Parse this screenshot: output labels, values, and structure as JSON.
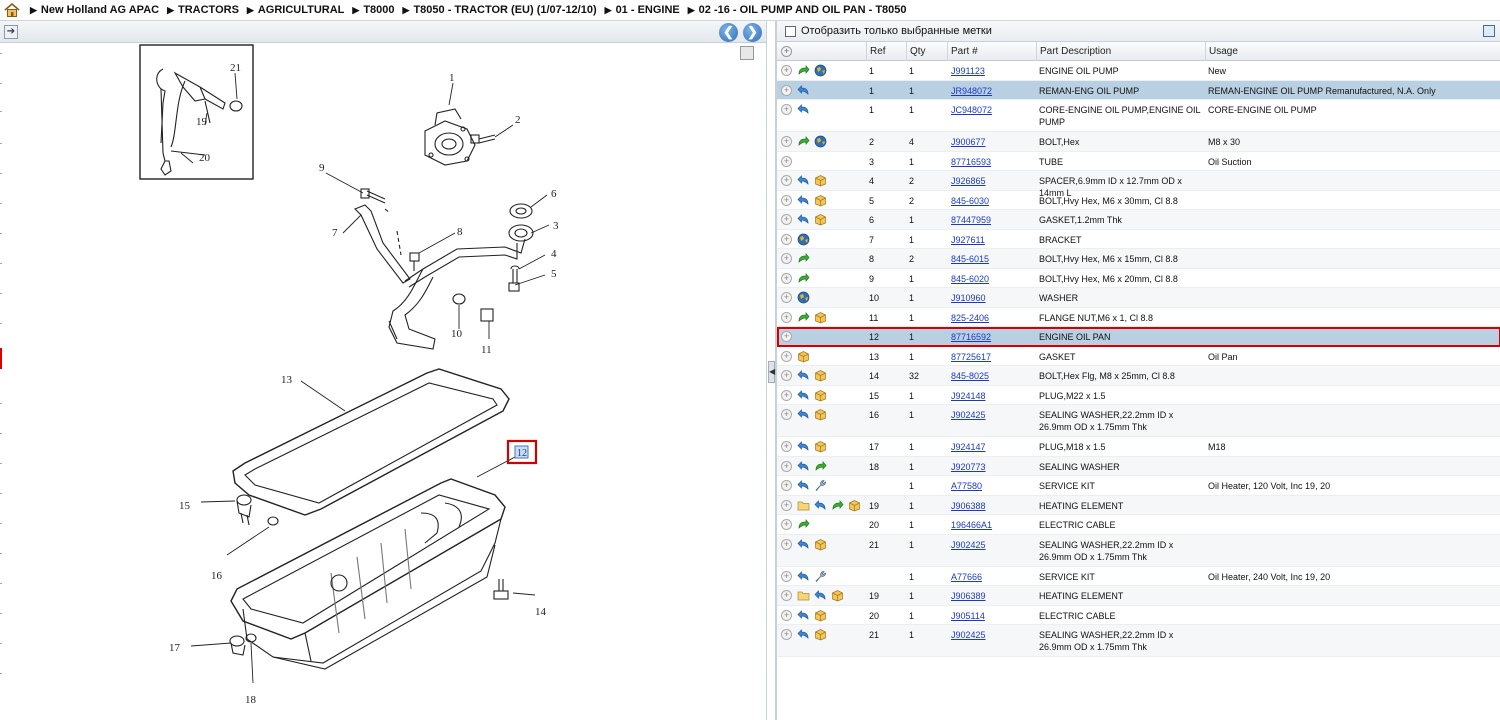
{
  "breadcrumb": [
    "New Holland AG APAC",
    "TRACTORS",
    "AGRICULTURAL",
    "T8000",
    "T8050 - TRACTOR (EU) (1/07-12/10)",
    "01 - ENGINE",
    "02 -16 - OIL PUMP AND OIL PAN - T8050"
  ],
  "filter": {
    "label": "Отобразить только выбранные метки",
    "checked": false
  },
  "columns": {
    "ref": "Ref",
    "qty": "Qty",
    "part": "Part #",
    "desc": "Part Description",
    "usage": "Usage"
  },
  "diagram": {
    "callouts": [
      "1",
      "2",
      "3",
      "4",
      "5",
      "6",
      "7",
      "8",
      "9",
      "10",
      "11",
      "13",
      "14",
      "15",
      "16",
      "17",
      "18",
      "19",
      "20",
      "21"
    ],
    "selected_callout": "12",
    "highlight_color": "#d40000"
  },
  "rows": [
    {
      "icons": [
        "arrow-green",
        "globe"
      ],
      "ref": "1",
      "qty": "1",
      "part": "J991123",
      "desc": "ENGINE OIL PUMP",
      "usage": "New",
      "lines": 1,
      "state": ""
    },
    {
      "icons": [
        "arrow-blue"
      ],
      "ref": "1",
      "qty": "1",
      "part": "JR948072",
      "desc": "REMAN-ENG OIL PUMP",
      "usage": "REMAN-ENGINE OIL PUMP Remanufactured, N.A. Only",
      "lines": 1,
      "state": "selected"
    },
    {
      "icons": [
        "arrow-blue"
      ],
      "ref": "1",
      "qty": "1",
      "part": "JC948072",
      "desc": "CORE-ENGINE OIL PUMP,ENGINE OIL PUMP",
      "usage": "CORE-ENGINE OIL PUMP",
      "lines": 2,
      "state": ""
    },
    {
      "icons": [
        "arrow-green",
        "globe"
      ],
      "ref": "2",
      "qty": "4",
      "part": "J900677",
      "desc": "BOLT,Hex",
      "usage": "M8 x 30",
      "lines": 1,
      "state": ""
    },
    {
      "icons": [],
      "ref": "3",
      "qty": "1",
      "part": "87716593",
      "desc": "TUBE",
      "usage": "Oil Suction",
      "lines": 1,
      "state": ""
    },
    {
      "icons": [
        "arrow-blue",
        "box"
      ],
      "ref": "4",
      "qty": "2",
      "part": "J926865",
      "desc": "SPACER,6.9mm ID x 12.7mm OD x 14mm L",
      "usage": "",
      "lines": 1,
      "state": ""
    },
    {
      "icons": [
        "arrow-blue",
        "box"
      ],
      "ref": "5",
      "qty": "2",
      "part": "845-6030",
      "desc": "BOLT,Hvy Hex, M6 x 30mm, Cl 8.8",
      "usage": "",
      "lines": 1,
      "state": ""
    },
    {
      "icons": [
        "arrow-blue",
        "box"
      ],
      "ref": "6",
      "qty": "1",
      "part": "87447959",
      "desc": "GASKET,1.2mm Thk",
      "usage": "",
      "lines": 1,
      "state": ""
    },
    {
      "icons": [
        "globe"
      ],
      "ref": "7",
      "qty": "1",
      "part": "J927611",
      "desc": "BRACKET",
      "usage": "",
      "lines": 1,
      "state": ""
    },
    {
      "icons": [
        "arrow-green"
      ],
      "ref": "8",
      "qty": "2",
      "part": "845-6015",
      "desc": "BOLT,Hvy Hex, M6 x 15mm, Cl 8.8",
      "usage": "",
      "lines": 1,
      "state": ""
    },
    {
      "icons": [
        "arrow-green"
      ],
      "ref": "9",
      "qty": "1",
      "part": "845-6020",
      "desc": "BOLT,Hvy Hex, M6 x 20mm, Cl 8.8",
      "usage": "",
      "lines": 1,
      "state": ""
    },
    {
      "icons": [
        "globe"
      ],
      "ref": "10",
      "qty": "1",
      "part": "J910960",
      "desc": "WASHER",
      "usage": "",
      "lines": 1,
      "state": ""
    },
    {
      "icons": [
        "arrow-green",
        "box"
      ],
      "ref": "11",
      "qty": "1",
      "part": "825-2406",
      "desc": "FLANGE NUT,M6 x 1, Cl 8.8",
      "usage": "",
      "lines": 1,
      "state": ""
    },
    {
      "icons": [],
      "ref": "12",
      "qty": "1",
      "part": "87716592",
      "desc": "ENGINE OIL PAN",
      "usage": "",
      "lines": 1,
      "state": "highlight"
    },
    {
      "icons": [
        "box"
      ],
      "ref": "13",
      "qty": "1",
      "part": "87725617",
      "desc": "GASKET",
      "usage": "Oil Pan",
      "lines": 1,
      "state": ""
    },
    {
      "icons": [
        "arrow-blue",
        "box"
      ],
      "ref": "14",
      "qty": "32",
      "part": "845-8025",
      "desc": "BOLT,Hex Flg, M8 x 25mm, Cl 8.8",
      "usage": "",
      "lines": 1,
      "state": ""
    },
    {
      "icons": [
        "arrow-blue",
        "box"
      ],
      "ref": "15",
      "qty": "1",
      "part": "J924148",
      "desc": "PLUG,M22 x 1.5",
      "usage": "",
      "lines": 1,
      "state": ""
    },
    {
      "icons": [
        "arrow-blue",
        "box"
      ],
      "ref": "16",
      "qty": "1",
      "part": "J902425",
      "desc": "SEALING WASHER,22.2mm ID x 26.9mm OD x 1.75mm Thk",
      "usage": "",
      "lines": 2,
      "state": ""
    },
    {
      "icons": [
        "arrow-blue",
        "box"
      ],
      "ref": "17",
      "qty": "1",
      "part": "J924147",
      "desc": "PLUG,M18 x 1.5",
      "usage": "M18",
      "lines": 1,
      "state": ""
    },
    {
      "icons": [
        "arrow-blue",
        "arrow-green"
      ],
      "ref": "18",
      "qty": "1",
      "part": "J920773",
      "desc": "SEALING WASHER",
      "usage": "",
      "lines": 1,
      "state": ""
    },
    {
      "icons": [
        "arrow-blue",
        "wrench"
      ],
      "ref": "",
      "qty": "1",
      "part": "A77580",
      "desc": "SERVICE KIT",
      "usage": "Oil Heater, 120 Volt, Inc 19, 20",
      "lines": 1,
      "state": ""
    },
    {
      "icons": [
        "folder",
        "arrow-blue",
        "arrow-green",
        "box"
      ],
      "ref": "19",
      "qty": "1",
      "part": "J906388",
      "desc": "HEATING ELEMENT",
      "usage": "",
      "lines": 1,
      "state": ""
    },
    {
      "icons": [
        "arrow-green"
      ],
      "ref": "20",
      "qty": "1",
      "part": "196466A1",
      "desc": "ELECTRIC CABLE",
      "usage": "",
      "lines": 1,
      "state": ""
    },
    {
      "icons": [
        "arrow-blue",
        "box"
      ],
      "ref": "21",
      "qty": "1",
      "part": "J902425",
      "desc": "SEALING WASHER,22.2mm ID x 26.9mm OD x 1.75mm Thk",
      "usage": "",
      "lines": 2,
      "state": ""
    },
    {
      "icons": [
        "arrow-blue",
        "wrench"
      ],
      "ref": "",
      "qty": "1",
      "part": "A77666",
      "desc": "SERVICE KIT",
      "usage": "Oil Heater, 240 Volt, Inc 19, 20",
      "lines": 1,
      "state": ""
    },
    {
      "icons": [
        "folder",
        "arrow-blue",
        "box"
      ],
      "ref": "19",
      "qty": "1",
      "part": "J906389",
      "desc": "HEATING ELEMENT",
      "usage": "",
      "lines": 1,
      "state": ""
    },
    {
      "icons": [
        "arrow-blue",
        "box"
      ],
      "ref": "20",
      "qty": "1",
      "part": "J905114",
      "desc": "ELECTRIC CABLE",
      "usage": "",
      "lines": 1,
      "state": ""
    },
    {
      "icons": [
        "arrow-blue",
        "box"
      ],
      "ref": "21",
      "qty": "1",
      "part": "J902425",
      "desc": "SEALING WASHER,22.2mm ID x 26.9mm OD x 1.75mm Thk",
      "usage": "",
      "lines": 2,
      "state": ""
    }
  ]
}
